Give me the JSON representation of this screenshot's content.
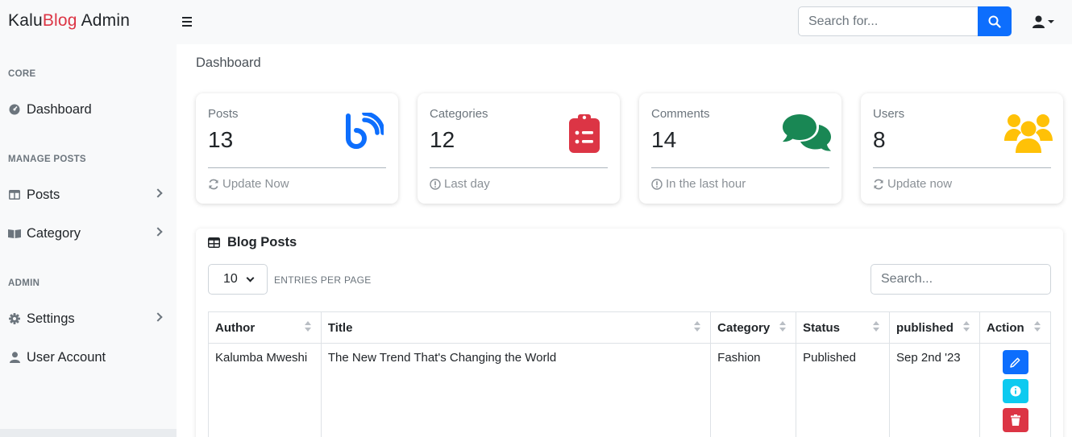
{
  "brand": {
    "part1": "Kalu",
    "part2": "Blog",
    "part3": " Admin"
  },
  "topbar": {
    "search_placeholder": "Search for...",
    "menu_icon": "bars-icon",
    "search_icon": "search-icon",
    "user_icon": "user-icon"
  },
  "sidebar": {
    "sections": {
      "core": "CORE",
      "manage_posts": "MANAGE POSTS",
      "admin": "ADMIN"
    },
    "items": {
      "dashboard": "Dashboard",
      "posts": "Posts",
      "category": "Category",
      "settings": "Settings",
      "user_account": "User Account"
    }
  },
  "page": {
    "title": "Dashboard"
  },
  "cards": [
    {
      "label": "Posts",
      "value": "13",
      "footer": "Update Now",
      "icon": "blog-icon",
      "color": "#0d6efd"
    },
    {
      "label": "Categories",
      "value": "12",
      "footer": "Last day",
      "icon": "clipboard-list-icon",
      "color": "#dc3545"
    },
    {
      "label": "Comments",
      "value": "14",
      "footer": "In the last hour",
      "icon": "comments-icon",
      "color": "#198754"
    },
    {
      "label": "Users",
      "value": "8",
      "footer": "Update now",
      "icon": "users-icon",
      "color": "#ffc107"
    }
  ],
  "blog_posts": {
    "title": "Blog Posts",
    "entries_value": "10",
    "entries_label": "ENTRIES PER PAGE",
    "search_placeholder": "Search...",
    "columns": [
      "Author",
      "Title",
      "Category",
      "Status",
      "published",
      "Action"
    ],
    "rows": [
      {
        "author": "Kalumba Mweshi",
        "title": "The New Trend That's Changing the World",
        "category": "Fashion",
        "status": "Published",
        "published": "Sep 2nd '23"
      }
    ]
  },
  "colors": {
    "primary": "#0d6efd",
    "info": "#0dcaf0",
    "danger": "#dc3545",
    "success": "#198754",
    "warning": "#ffc107"
  }
}
